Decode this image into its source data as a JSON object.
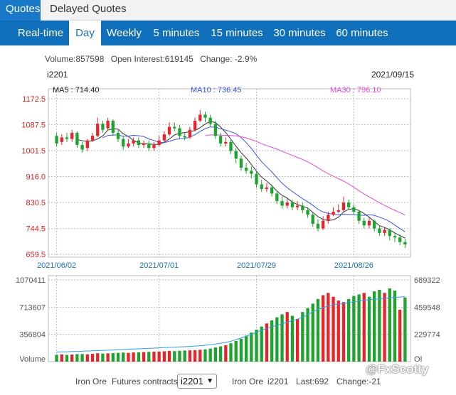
{
  "top_tabs": {
    "quotes": "Quotes",
    "delayed": "Delayed Quotes"
  },
  "periods": [
    {
      "label": "Real-time",
      "active": false
    },
    {
      "label": "Day",
      "active": true
    },
    {
      "label": "Weekly",
      "active": false
    },
    {
      "label": "5 minutes",
      "active": false
    },
    {
      "label": "15 minutes",
      "active": false
    },
    {
      "label": "30 minutes",
      "active": false
    },
    {
      "label": "60 minutes",
      "active": false
    }
  ],
  "stats": {
    "volume": "Volume:857598",
    "open_interest": "Open Interest:619145",
    "change": "Change: -2.9%"
  },
  "chart_header": {
    "code": "i2201",
    "date": "2021/09/15"
  },
  "legend": {
    "ma5": "MA5 : 714.40",
    "ma10": "MA10 : 736.45",
    "ma30": "MA30 : 796.10"
  },
  "bottom": {
    "product": "Iron Ore",
    "futures": "Futures contracts",
    "selected": "i2201",
    "product2": "Iron Ore",
    "code2": "i2201",
    "last": "Last:692",
    "change": "Change:-21"
  },
  "watermark": "@FxScotty",
  "colors": {
    "up": "#e8242b",
    "down": "#1fa32f",
    "ma5": "#333333",
    "ma10": "#3a56e0",
    "ma30": "#e04bd8",
    "oi": "#2aa1e6",
    "accent": "#0f6fba"
  },
  "chart_data": {
    "type": "candlestick",
    "price_ticks": [
      "1172.5",
      "1087.5",
      "1001.5",
      "916.0",
      "830.5",
      "744.5",
      "659.5"
    ],
    "price_range": [
      659.5,
      1172.5
    ],
    "date_ticks": [
      "2021/06/02",
      "2021/07/01",
      "2021/07/29",
      "2021/08/26"
    ],
    "date_tick_index": [
      0,
      20,
      39,
      58
    ],
    "volume_ticks_left": [
      "1070411",
      "713607",
      "356804",
      "Volume"
    ],
    "volume_ticks_right": [
      "689322",
      "459548",
      "229774",
      "OI"
    ],
    "volume_range": [
      0,
      1070411
    ],
    "oi_range": [
      0,
      689322
    ],
    "candles": [
      [
        1050,
        1025,
        1060,
        1015
      ],
      [
        1030,
        1045,
        1055,
        1020
      ],
      [
        1045,
        1040,
        1060,
        1030
      ],
      [
        1040,
        1060,
        1070,
        1030
      ],
      [
        1060,
        1020,
        1065,
        1010
      ],
      [
        1020,
        1005,
        1030,
        995
      ],
      [
        1010,
        1035,
        1040,
        1000
      ],
      [
        1035,
        1050,
        1060,
        1030
      ],
      [
        1050,
        1090,
        1110,
        1045
      ],
      [
        1090,
        1070,
        1100,
        1060
      ],
      [
        1075,
        1100,
        1110,
        1070
      ],
      [
        1100,
        1060,
        1105,
        1050
      ],
      [
        1060,
        1040,
        1070,
        1030
      ],
      [
        1040,
        1015,
        1050,
        1005
      ],
      [
        1015,
        1025,
        1040,
        1010
      ],
      [
        1025,
        1035,
        1045,
        1015
      ],
      [
        1035,
        1020,
        1045,
        1010
      ],
      [
        1020,
        1025,
        1035,
        1010
      ],
      [
        1025,
        1010,
        1035,
        1000
      ],
      [
        1010,
        1020,
        1030,
        1000
      ],
      [
        1020,
        1035,
        1050,
        1015
      ],
      [
        1035,
        1055,
        1065,
        1030
      ],
      [
        1055,
        1080,
        1095,
        1050
      ],
      [
        1080,
        1075,
        1095,
        1065
      ],
      [
        1075,
        1050,
        1085,
        1040
      ],
      [
        1050,
        1045,
        1060,
        1035
      ],
      [
        1045,
        1070,
        1080,
        1040
      ],
      [
        1070,
        1100,
        1110,
        1065
      ],
      [
        1100,
        1120,
        1135,
        1095
      ],
      [
        1120,
        1110,
        1130,
        1095
      ],
      [
        1110,
        1090,
        1120,
        1080
      ],
      [
        1090,
        1050,
        1100,
        1040
      ],
      [
        1050,
        1025,
        1060,
        1015
      ],
      [
        1025,
        1030,
        1045,
        1015
      ],
      [
        1030,
        1000,
        1040,
        990
      ],
      [
        1000,
        975,
        1010,
        960
      ],
      [
        975,
        945,
        985,
        935
      ],
      [
        945,
        935,
        960,
        925
      ],
      [
        935,
        925,
        950,
        910
      ],
      [
        925,
        890,
        935,
        880
      ],
      [
        890,
        875,
        905,
        865
      ],
      [
        875,
        880,
        895,
        865
      ],
      [
        880,
        860,
        890,
        850
      ],
      [
        860,
        835,
        870,
        825
      ],
      [
        835,
        820,
        850,
        810
      ],
      [
        820,
        830,
        845,
        810
      ],
      [
        830,
        815,
        840,
        805
      ],
      [
        815,
        820,
        835,
        805
      ],
      [
        820,
        805,
        830,
        795
      ],
      [
        805,
        790,
        815,
        780
      ],
      [
        790,
        760,
        800,
        750
      ],
      [
        760,
        745,
        775,
        735
      ],
      [
        745,
        770,
        785,
        740
      ],
      [
        770,
        790,
        800,
        760
      ],
      [
        790,
        800,
        815,
        785
      ],
      [
        800,
        805,
        825,
        795
      ],
      [
        805,
        830,
        850,
        800
      ],
      [
        830,
        815,
        840,
        805
      ],
      [
        815,
        800,
        825,
        790
      ],
      [
        800,
        770,
        805,
        760
      ],
      [
        770,
        755,
        780,
        745
      ],
      [
        755,
        770,
        780,
        745
      ],
      [
        770,
        745,
        775,
        735
      ],
      [
        745,
        730,
        755,
        720
      ],
      [
        730,
        740,
        750,
        720
      ],
      [
        740,
        720,
        745,
        705
      ],
      [
        720,
        715,
        730,
        700
      ],
      [
        715,
        700,
        725,
        690
      ],
      [
        700,
        692,
        712,
        680
      ]
    ],
    "volumes": [
      [
        90000,
        "down"
      ],
      [
        95000,
        "up"
      ],
      [
        88000,
        "down"
      ],
      [
        92000,
        "up"
      ],
      [
        98000,
        "down"
      ],
      [
        100000,
        "down"
      ],
      [
        96000,
        "up"
      ],
      [
        102000,
        "up"
      ],
      [
        110000,
        "up"
      ],
      [
        105000,
        "down"
      ],
      [
        108000,
        "up"
      ],
      [
        112000,
        "down"
      ],
      [
        115000,
        "down"
      ],
      [
        118000,
        "down"
      ],
      [
        114000,
        "up"
      ],
      [
        120000,
        "up"
      ],
      [
        122000,
        "down"
      ],
      [
        125000,
        "up"
      ],
      [
        128000,
        "down"
      ],
      [
        130000,
        "up"
      ],
      [
        132000,
        "up"
      ],
      [
        135000,
        "up"
      ],
      [
        140000,
        "up"
      ],
      [
        138000,
        "down"
      ],
      [
        142000,
        "down"
      ],
      [
        145000,
        "down"
      ],
      [
        148000,
        "up"
      ],
      [
        150000,
        "up"
      ],
      [
        155000,
        "up"
      ],
      [
        160000,
        "down"
      ],
      [
        170000,
        "down"
      ],
      [
        185000,
        "down"
      ],
      [
        200000,
        "down"
      ],
      [
        215000,
        "up"
      ],
      [
        240000,
        "down"
      ],
      [
        270000,
        "down"
      ],
      [
        300000,
        "down"
      ],
      [
        340000,
        "down"
      ],
      [
        380000,
        "down"
      ],
      [
        420000,
        "down"
      ],
      [
        460000,
        "down"
      ],
      [
        500000,
        "up"
      ],
      [
        540000,
        "down"
      ],
      [
        580000,
        "down"
      ],
      [
        620000,
        "down"
      ],
      [
        650000,
        "up"
      ],
      [
        600000,
        "down"
      ],
      [
        560000,
        "up"
      ],
      [
        650000,
        "down"
      ],
      [
        700000,
        "down"
      ],
      [
        760000,
        "down"
      ],
      [
        820000,
        "down"
      ],
      [
        870000,
        "up"
      ],
      [
        900000,
        "up"
      ],
      [
        850000,
        "up"
      ],
      [
        800000,
        "up"
      ],
      [
        780000,
        "up"
      ],
      [
        820000,
        "down"
      ],
      [
        860000,
        "down"
      ],
      [
        880000,
        "down"
      ],
      [
        900000,
        "up"
      ],
      [
        850000,
        "down"
      ],
      [
        920000,
        "down"
      ],
      [
        940000,
        "down"
      ],
      [
        900000,
        "up"
      ],
      [
        960000,
        "down"
      ],
      [
        930000,
        "down"
      ],
      [
        680000,
        "up"
      ],
      [
        840000,
        "down"
      ]
    ],
    "open_interest": [
      80000,
      82000,
      83000,
      85000,
      86000,
      88000,
      90000,
      91000,
      93000,
      95000,
      96000,
      98000,
      100000,
      102000,
      104000,
      106000,
      108000,
      110000,
      112000,
      114000,
      116000,
      118000,
      120000,
      122000,
      124000,
      126000,
      128000,
      131000,
      134000,
      138000,
      142000,
      148000,
      155000,
      162000,
      172000,
      185000,
      200000,
      215000,
      230000,
      248000,
      265000,
      280000,
      295000,
      305000,
      318000,
      332000,
      345000,
      358000,
      375000,
      395000,
      420000,
      440000,
      455000,
      470000,
      480000,
      485000,
      490000,
      498000,
      505000,
      512000,
      518000,
      522000,
      526000,
      530000,
      534000,
      538000,
      542000,
      545000,
      548000
    ]
  }
}
